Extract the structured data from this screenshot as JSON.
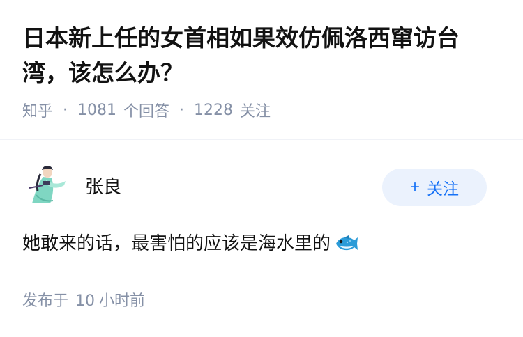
{
  "question": {
    "title": "日本新上任的女首相如果效仿佩洛西窜访台湾，该怎么办？",
    "source": "知乎",
    "answer_count": "1081",
    "answer_label": "个回答",
    "follow_count": "1228",
    "follow_label": "关注",
    "separator": "·"
  },
  "answer": {
    "author_name": "张良",
    "follow_button": "关注",
    "follow_plus": "+",
    "content": "她敢来的话，最害怕的应该是海水里的",
    "content_emoji": "fish-icon",
    "published_prefix": "发布于",
    "published_value": "10",
    "published_suffix": "小时前"
  },
  "colors": {
    "accent": "#1772f6",
    "button_bg": "#ebf2fd",
    "meta_text": "#8590a6",
    "text": "#121212"
  }
}
